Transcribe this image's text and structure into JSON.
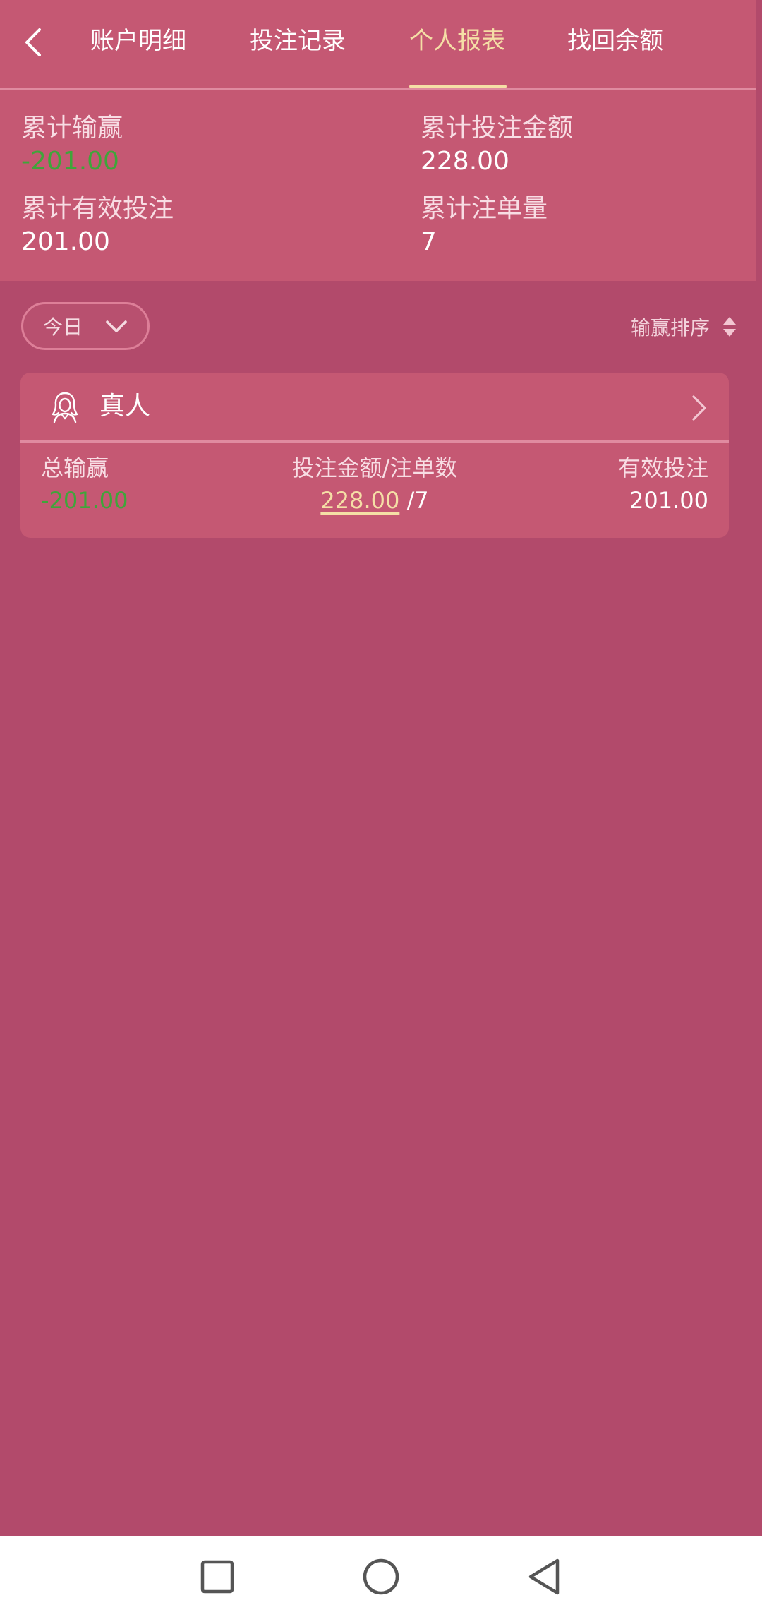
{
  "header": {
    "tabs": [
      {
        "label": "账户明细",
        "active": false
      },
      {
        "label": "投注记录",
        "active": false
      },
      {
        "label": "个人报表",
        "active": true
      },
      {
        "label": "找回余额",
        "active": false
      }
    ]
  },
  "summary": {
    "total_win_loss_label": "累计输赢",
    "total_win_loss_value": "-201.00",
    "total_bet_amount_label": "累计投注金额",
    "total_bet_amount_value": "228.00",
    "total_valid_bet_label": "累计有效投注",
    "total_valid_bet_value": "201.00",
    "total_order_count_label": "累计注单量",
    "total_order_count_value": "7"
  },
  "filter": {
    "date_label": "今日",
    "sort_label": "输赢排序"
  },
  "card": {
    "title": "真人",
    "win_loss_label": "总输赢",
    "win_loss_value": "-201.00",
    "bet_label": "投注金额/注单数",
    "bet_amount": "228.00",
    "bet_count": "/7",
    "valid_label": "有效投注",
    "valid_value": "201.00"
  },
  "colors": {
    "background": "#b24a6b",
    "panel": "#c55873",
    "accent": "#f5dfa6",
    "negative": "#3fa53a"
  }
}
